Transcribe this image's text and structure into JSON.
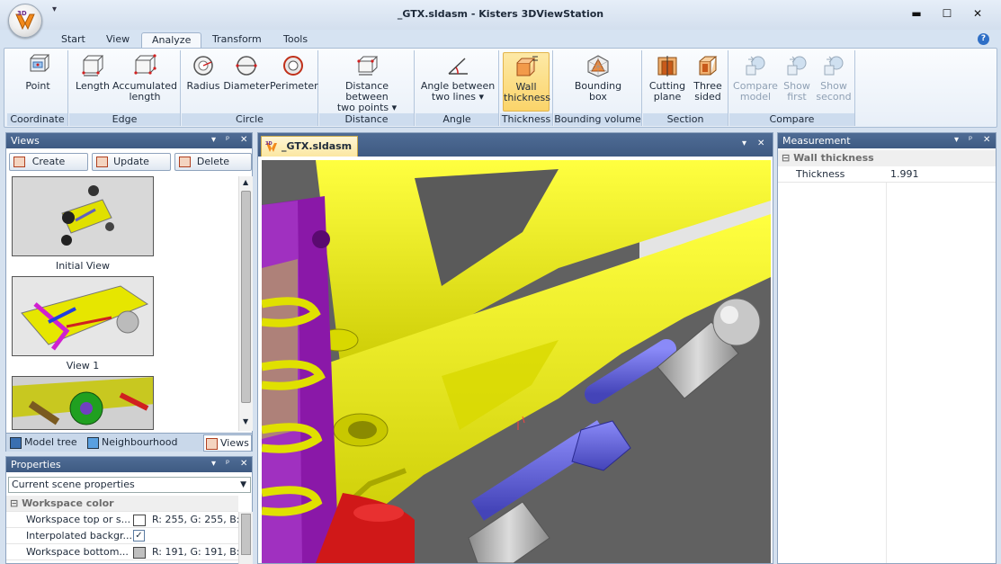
{
  "window": {
    "title": "_GTX.sldasm - Kisters 3DViewStation",
    "minimize": "▬",
    "maximize": "☐",
    "close": "✕"
  },
  "app_logo": {
    "letters": "3D",
    "icon": "3dviewstation-logo-icon"
  },
  "quick_access": {
    "arrow": "▾"
  },
  "tabs": [
    "Start",
    "View",
    "Analyze",
    "Transform",
    "Tools"
  ],
  "active_tab": "Analyze",
  "help": "?",
  "ribbon": {
    "groups": [
      {
        "label": "Coordinate",
        "buttons": [
          {
            "label": "Point",
            "icon": "point-icon"
          }
        ]
      },
      {
        "label": "Edge",
        "buttons": [
          {
            "label": "Length",
            "icon": "length-icon"
          },
          {
            "label": "Accumulated length",
            "icon": "accumulated-length-icon"
          }
        ]
      },
      {
        "label": "Circle",
        "buttons": [
          {
            "label": "Radius",
            "icon": "radius-icon"
          },
          {
            "label": "Diameter",
            "icon": "diameter-icon"
          },
          {
            "label": "Perimeter",
            "icon": "perimeter-icon"
          }
        ]
      },
      {
        "label": "Distance",
        "buttons": [
          {
            "label": "Distance between two points",
            "line1": "Distance between",
            "line2": "two points",
            "icon": "distance-icon"
          }
        ]
      },
      {
        "label": "Angle",
        "buttons": [
          {
            "label": "Angle between two lines",
            "line1": "Angle between",
            "line2": "two lines",
            "icon": "angle-icon"
          }
        ]
      },
      {
        "label": "Thickness",
        "buttons": [
          {
            "label": "Wall thickness",
            "line1": "Wall",
            "line2": "thickness",
            "icon": "wall-thickness-icon"
          }
        ]
      },
      {
        "label": "Bounding volume",
        "buttons": [
          {
            "label": "Bounding box",
            "line1": "Bounding",
            "line2": "box",
            "icon": "bounding-box-icon"
          }
        ]
      },
      {
        "label": "Section",
        "buttons": [
          {
            "label": "Cutting plane",
            "line1": "Cutting",
            "line2": "plane",
            "icon": "cutting-plane-icon"
          },
          {
            "label": "Three sided",
            "line1": "Three",
            "line2": "sided",
            "icon": "three-sided-icon"
          }
        ]
      },
      {
        "label": "Compare",
        "buttons": [
          {
            "label": "Compare model",
            "line1": "Compare",
            "line2": "model",
            "icon": "compare-model-icon"
          },
          {
            "label": "Show first",
            "line1": "Show",
            "line2": "first",
            "icon": "show-first-icon"
          },
          {
            "label": "Show second",
            "line1": "Show",
            "line2": "second",
            "icon": "show-second-icon"
          }
        ]
      }
    ]
  },
  "views_panel": {
    "title": "Views",
    "controls": {
      "dropdown": "▾",
      "pin": "ᵖ",
      "close": "✕"
    },
    "buttons": [
      "Create",
      "Update",
      "Delete"
    ],
    "thumbnails": [
      "Initial View",
      "View 1"
    ],
    "bottom_tabs": [
      "Model tree",
      "Neighbourhood se...",
      "Views"
    ]
  },
  "properties_panel": {
    "title": "Properties",
    "select": "Current scene properties",
    "category": "Workspace color",
    "rows": [
      {
        "name": "Workspace top or s...",
        "value": "R: 255, G: 255, B: 25",
        "swatch": "#ffffff"
      },
      {
        "name": "Interpolated backgr...",
        "value": "✓"
      },
      {
        "name": "Workspace bottom...",
        "value": "R: 191, G: 191, B: 19",
        "swatch": "#bfbfbf"
      }
    ]
  },
  "document": {
    "tab": "_GTX.sldasm",
    "controls": {
      "dropdown": "▾",
      "close": "✕"
    }
  },
  "measurement_panel": {
    "title": "Measurement",
    "controls": {
      "dropdown": "▾",
      "pin": "ᵖ",
      "close": "✕"
    },
    "category": "Wall thickness",
    "rows": [
      {
        "name": "Thickness",
        "value": "1.991"
      }
    ]
  },
  "colors": {
    "accent": "#3e5a82",
    "ribbon_bg": "#e8eff8",
    "model_yellow": "#f2f200",
    "model_purple": "#8a18a8",
    "model_blue": "#6a6ae0"
  }
}
